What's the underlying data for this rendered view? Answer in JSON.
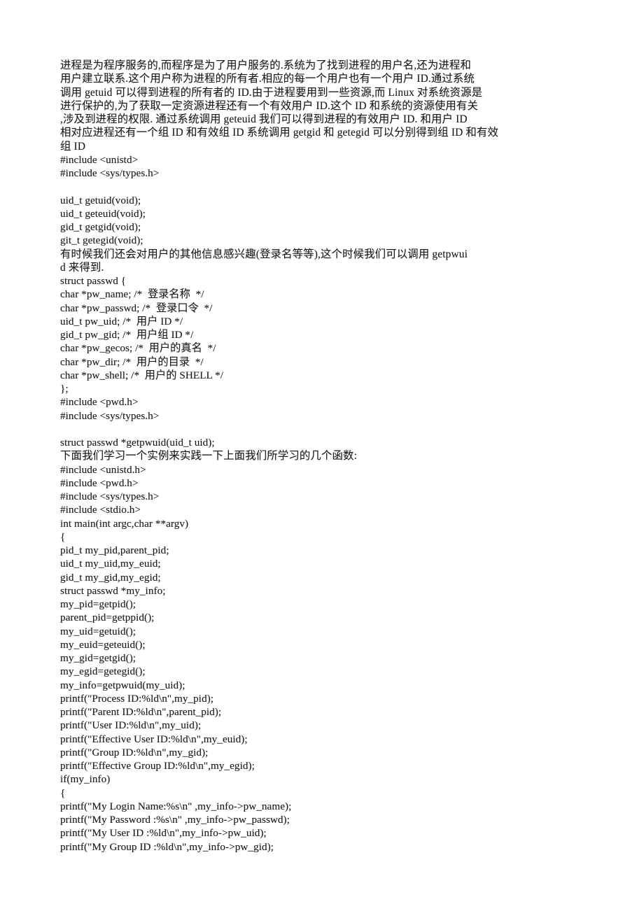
{
  "document": {
    "page_background": "#ffffff",
    "text_color": "#1b1b1b",
    "lines": [
      {
        "id": "l1",
        "type": "cjk",
        "text": "进程是为程序服务的,而程序是为了用户服务的.系统为了找到进程的用户名,还为进程和"
      },
      {
        "id": "l2",
        "type": "cjk",
        "text": "用户建立联系.这个用户称为进程的所有者.相应的每一个用户也有一个用户 ID.通过系统"
      },
      {
        "id": "l3",
        "type": "cjk",
        "text": "调用 getuid 可以得到进程的所有者的 ID.由于进程要用到一些资源,而 Linux 对系统资源是"
      },
      {
        "id": "l4",
        "type": "cjk",
        "text": "进行保护的,为了获取一定资源进程还有一个有效用户 ID.这个 ID 和系统的资源使用有关"
      },
      {
        "id": "l5",
        "type": "cjk",
        "text": ",涉及到进程的权限. 通过系统调用 geteuid 我们可以得到进程的有效用户 ID. 和用户 ID"
      },
      {
        "id": "l6",
        "type": "cjk",
        "text": "相对应进程还有一个组 ID 和有效组 ID 系统调用 getgid 和 getegid 可以分别得到组 ID 和有效"
      },
      {
        "id": "l7",
        "type": "cjk",
        "text": "组 ID"
      },
      {
        "id": "l8",
        "type": "code",
        "text": "#include <unistd>"
      },
      {
        "id": "l9",
        "type": "code",
        "text": "#include <sys/types.h>"
      },
      {
        "id": "l10",
        "type": "blank",
        "text": ""
      },
      {
        "id": "l11",
        "type": "code",
        "text": "uid_t getuid(void);"
      },
      {
        "id": "l12",
        "type": "code",
        "text": "uid_t geteuid(void);"
      },
      {
        "id": "l13",
        "type": "code",
        "text": "gid_t getgid(void);"
      },
      {
        "id": "l14",
        "type": "code",
        "text": "git_t getegid(void);"
      },
      {
        "id": "l15",
        "type": "cjk",
        "text": "有时候我们还会对用户的其他信息感兴趣(登录名等等),这个时候我们可以调用 getpwui"
      },
      {
        "id": "l16",
        "type": "cjk",
        "text": "d 来得到."
      },
      {
        "id": "l17",
        "type": "code",
        "text": "struct passwd {"
      },
      {
        "id": "l18",
        "type": "code",
        "text": "char *pw_name; /*  登录名称  */"
      },
      {
        "id": "l19",
        "type": "code",
        "text": "char *pw_passwd; /*  登录口令  */"
      },
      {
        "id": "l20",
        "type": "code",
        "text": "uid_t pw_uid; /*  用户 ID */"
      },
      {
        "id": "l21",
        "type": "code",
        "text": "gid_t pw_gid; /*  用户组 ID */"
      },
      {
        "id": "l22",
        "type": "code",
        "text": "char *pw_gecos; /*  用户的真名  */"
      },
      {
        "id": "l23",
        "type": "code",
        "text": "char *pw_dir; /*  用户的目录  */"
      },
      {
        "id": "l24",
        "type": "code",
        "text": "char *pw_shell; /*  用户的 SHELL */"
      },
      {
        "id": "l25",
        "type": "code",
        "text": "};"
      },
      {
        "id": "l26",
        "type": "code",
        "text": "#include <pwd.h>"
      },
      {
        "id": "l27",
        "type": "code",
        "text": "#include <sys/types.h>"
      },
      {
        "id": "l28",
        "type": "blank",
        "text": ""
      },
      {
        "id": "l29",
        "type": "code",
        "text": "struct passwd *getpwuid(uid_t uid);"
      },
      {
        "id": "l30",
        "type": "cjk",
        "text": "下面我们学习一个实例来实践一下上面我们所学习的几个函数:"
      },
      {
        "id": "l31",
        "type": "code",
        "text": "#include <unistd.h>"
      },
      {
        "id": "l32",
        "type": "code",
        "text": "#include <pwd.h>"
      },
      {
        "id": "l33",
        "type": "code",
        "text": "#include <sys/types.h>"
      },
      {
        "id": "l34",
        "type": "code",
        "text": "#include <stdio.h>"
      },
      {
        "id": "l35",
        "type": "code",
        "text": "int main(int argc,char **argv)"
      },
      {
        "id": "l36",
        "type": "code",
        "text": "{"
      },
      {
        "id": "l37",
        "type": "code",
        "text": "pid_t my_pid,parent_pid;"
      },
      {
        "id": "l38",
        "type": "code",
        "text": "uid_t my_uid,my_euid;"
      },
      {
        "id": "l39",
        "type": "code",
        "text": "gid_t my_gid,my_egid;"
      },
      {
        "id": "l40",
        "type": "code",
        "text": "struct passwd *my_info;"
      },
      {
        "id": "l41",
        "type": "code",
        "text": "my_pid=getpid();"
      },
      {
        "id": "l42",
        "type": "code",
        "text": "parent_pid=getppid();"
      },
      {
        "id": "l43",
        "type": "code",
        "text": "my_uid=getuid();"
      },
      {
        "id": "l44",
        "type": "code",
        "text": "my_euid=geteuid();"
      },
      {
        "id": "l45",
        "type": "code",
        "text": "my_gid=getgid();"
      },
      {
        "id": "l46",
        "type": "code",
        "text": "my_egid=getegid();"
      },
      {
        "id": "l47",
        "type": "code",
        "text": "my_info=getpwuid(my_uid);"
      },
      {
        "id": "l48",
        "type": "code",
        "text": "printf(\"Process ID:%ld\\n\",my_pid);"
      },
      {
        "id": "l49",
        "type": "code",
        "text": "printf(\"Parent ID:%ld\\n\",parent_pid);"
      },
      {
        "id": "l50",
        "type": "code",
        "text": "printf(\"User ID:%ld\\n\",my_uid);"
      },
      {
        "id": "l51",
        "type": "code",
        "text": "printf(\"Effective User ID:%ld\\n\",my_euid);"
      },
      {
        "id": "l52",
        "type": "code",
        "text": "printf(\"Group ID:%ld\\n\",my_gid);"
      },
      {
        "id": "l53",
        "type": "code",
        "text": "printf(\"Effective Group ID:%ld\\n\",my_egid);"
      },
      {
        "id": "l54",
        "type": "code",
        "text": "if(my_info)"
      },
      {
        "id": "l55",
        "type": "code",
        "text": "{"
      },
      {
        "id": "l56",
        "type": "code",
        "text": "printf(\"My Login Name:%s\\n\" ,my_info->pw_name);"
      },
      {
        "id": "l57",
        "type": "code",
        "text": "printf(\"My Password :%s\\n\" ,my_info->pw_passwd);"
      },
      {
        "id": "l58",
        "type": "code",
        "text": "printf(\"My User ID :%ld\\n\",my_info->pw_uid);"
      },
      {
        "id": "l59",
        "type": "code",
        "text": "printf(\"My Group ID :%ld\\n\",my_info->pw_gid);"
      }
    ]
  }
}
